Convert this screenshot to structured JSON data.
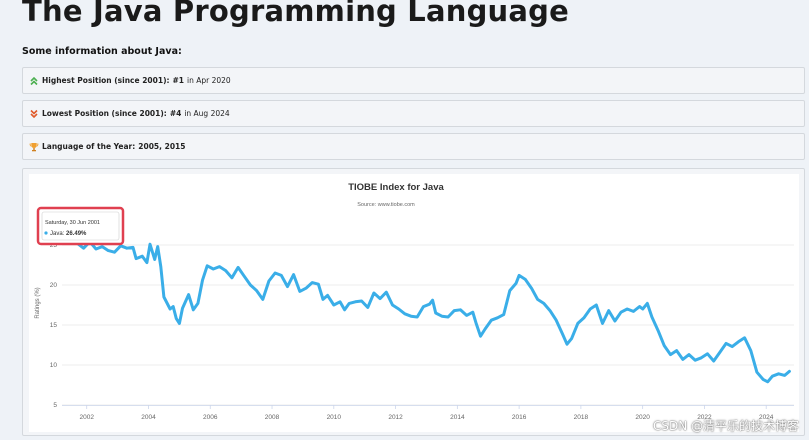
{
  "page": {
    "title": "The Java Programming Language",
    "subtitle": "Some information about Java:"
  },
  "info": [
    {
      "icon": "up-arrows-icon",
      "label": "Highest Position (since 2001):",
      "value": "#1",
      "suffix": "in Apr 2020"
    },
    {
      "icon": "down-arrows-icon",
      "label": "Lowest Position (since 2001):",
      "value": "#4",
      "suffix": "in Aug 2024"
    },
    {
      "icon": "trophy-icon",
      "label": "Language of the Year:",
      "value": "2005, 2015",
      "suffix": ""
    }
  ],
  "tooltip": {
    "date": "Saturday, 30 Jun 2001",
    "series": "Java:",
    "value": "26.49%"
  },
  "watermark": "CSDN @清平乐的技术博客",
  "colors": {
    "line": "#3aaee8",
    "highlight_border": "#e04050",
    "up_icon": "#4caf50",
    "down_icon": "#e05a2a"
  },
  "chart_data": {
    "type": "line",
    "title": "TIOBE Index for Java",
    "subtitle": "Source: www.tiobe.com",
    "ylabel": "Ratings (%)",
    "xlabel": "",
    "ylim": [
      5,
      30
    ],
    "yticks": [
      5,
      10,
      15,
      20,
      25
    ],
    "xlim": [
      2001.2,
      2024.9
    ],
    "xticks": [
      "2002",
      "2004",
      "2006",
      "2008",
      "2010",
      "2012",
      "2014",
      "2016",
      "2018",
      "2020",
      "2022",
      "2024"
    ],
    "grid": true,
    "series": [
      {
        "name": "Java",
        "points": [
          [
            2001.5,
            26.5
          ],
          [
            2001.7,
            25.2
          ],
          [
            2001.9,
            24.6
          ],
          [
            2002.1,
            25.4
          ],
          [
            2002.3,
            24.5
          ],
          [
            2002.5,
            24.8
          ],
          [
            2002.7,
            24.3
          ],
          [
            2002.9,
            24.1
          ],
          [
            2003.1,
            24.9
          ],
          [
            2003.3,
            24.6
          ],
          [
            2003.5,
            24.7
          ],
          [
            2003.6,
            23.3
          ],
          [
            2003.8,
            23.6
          ],
          [
            2003.95,
            22.8
          ],
          [
            2004.05,
            25.1
          ],
          [
            2004.2,
            23.2
          ],
          [
            2004.3,
            24.8
          ],
          [
            2004.4,
            22.3
          ],
          [
            2004.5,
            18.5
          ],
          [
            2004.7,
            17.0
          ],
          [
            2004.8,
            17.3
          ],
          [
            2004.9,
            15.8
          ],
          [
            2005.0,
            15.2
          ],
          [
            2005.1,
            17.1
          ],
          [
            2005.3,
            18.8
          ],
          [
            2005.45,
            16.9
          ],
          [
            2005.6,
            17.7
          ],
          [
            2005.75,
            20.6
          ],
          [
            2005.9,
            22.4
          ],
          [
            2006.1,
            22.0
          ],
          [
            2006.3,
            22.3
          ],
          [
            2006.5,
            21.8
          ],
          [
            2006.7,
            20.9
          ],
          [
            2006.9,
            22.2
          ],
          [
            2007.1,
            21.1
          ],
          [
            2007.3,
            20.0
          ],
          [
            2007.5,
            19.3
          ],
          [
            2007.7,
            18.2
          ],
          [
            2007.9,
            20.5
          ],
          [
            2008.1,
            21.5
          ],
          [
            2008.3,
            21.2
          ],
          [
            2008.5,
            19.8
          ],
          [
            2008.7,
            21.3
          ],
          [
            2008.9,
            19.2
          ],
          [
            2009.1,
            19.6
          ],
          [
            2009.3,
            20.3
          ],
          [
            2009.5,
            20.1
          ],
          [
            2009.65,
            18.2
          ],
          [
            2009.8,
            18.7
          ],
          [
            2010.0,
            17.5
          ],
          [
            2010.2,
            17.9
          ],
          [
            2010.35,
            16.9
          ],
          [
            2010.5,
            17.7
          ],
          [
            2010.7,
            17.9
          ],
          [
            2010.9,
            18.0
          ],
          [
            2011.1,
            17.2
          ],
          [
            2011.3,
            19.0
          ],
          [
            2011.5,
            18.3
          ],
          [
            2011.7,
            19.1
          ],
          [
            2011.9,
            17.5
          ],
          [
            2012.1,
            17.0
          ],
          [
            2012.3,
            16.4
          ],
          [
            2012.5,
            16.1
          ],
          [
            2012.7,
            16.0
          ],
          [
            2012.9,
            17.3
          ],
          [
            2013.1,
            17.6
          ],
          [
            2013.2,
            18.1
          ],
          [
            2013.3,
            16.5
          ],
          [
            2013.5,
            16.1
          ],
          [
            2013.7,
            16.0
          ],
          [
            2013.9,
            16.8
          ],
          [
            2014.1,
            16.9
          ],
          [
            2014.3,
            16.2
          ],
          [
            2014.5,
            16.6
          ],
          [
            2014.6,
            15.3
          ],
          [
            2014.75,
            13.6
          ],
          [
            2014.9,
            14.5
          ],
          [
            2015.1,
            15.6
          ],
          [
            2015.3,
            15.9
          ],
          [
            2015.5,
            16.3
          ],
          [
            2015.7,
            19.3
          ],
          [
            2015.9,
            20.2
          ],
          [
            2016.0,
            21.2
          ],
          [
            2016.2,
            20.7
          ],
          [
            2016.4,
            19.6
          ],
          [
            2016.6,
            18.2
          ],
          [
            2016.8,
            17.7
          ],
          [
            2017.0,
            16.8
          ],
          [
            2017.2,
            15.6
          ],
          [
            2017.4,
            13.9
          ],
          [
            2017.55,
            12.6
          ],
          [
            2017.7,
            13.3
          ],
          [
            2017.9,
            15.2
          ],
          [
            2018.1,
            15.9
          ],
          [
            2018.3,
            17.0
          ],
          [
            2018.5,
            17.5
          ],
          [
            2018.7,
            15.2
          ],
          [
            2018.9,
            16.8
          ],
          [
            2019.1,
            15.5
          ],
          [
            2019.3,
            16.6
          ],
          [
            2019.5,
            17.0
          ],
          [
            2019.7,
            16.7
          ],
          [
            2019.9,
            17.3
          ],
          [
            2020.0,
            17.0
          ],
          [
            2020.15,
            17.7
          ],
          [
            2020.3,
            16.0
          ],
          [
            2020.5,
            14.3
          ],
          [
            2020.7,
            12.4
          ],
          [
            2020.9,
            11.3
          ],
          [
            2021.1,
            11.8
          ],
          [
            2021.3,
            10.7
          ],
          [
            2021.5,
            11.3
          ],
          [
            2021.7,
            10.6
          ],
          [
            2021.9,
            10.9
          ],
          [
            2022.1,
            11.4
          ],
          [
            2022.3,
            10.5
          ],
          [
            2022.5,
            11.6
          ],
          [
            2022.7,
            12.7
          ],
          [
            2022.9,
            12.3
          ],
          [
            2023.1,
            12.9
          ],
          [
            2023.3,
            13.4
          ],
          [
            2023.5,
            11.8
          ],
          [
            2023.7,
            9.1
          ],
          [
            2023.9,
            8.2
          ],
          [
            2024.05,
            7.9
          ],
          [
            2024.2,
            8.6
          ],
          [
            2024.4,
            8.9
          ],
          [
            2024.6,
            8.7
          ],
          [
            2024.75,
            9.2
          ]
        ]
      }
    ]
  }
}
